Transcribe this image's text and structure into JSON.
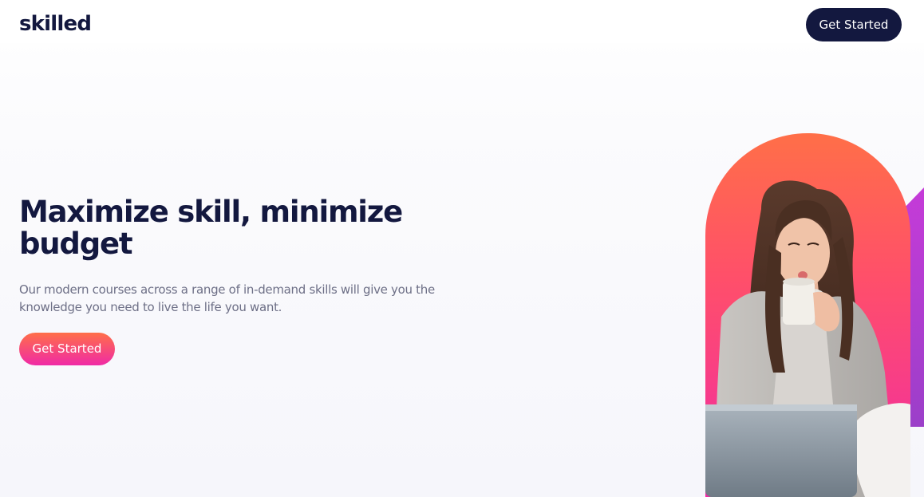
{
  "header": {
    "logo_text": "skilled",
    "cta_label": "Get Started"
  },
  "hero": {
    "title": "Maximize skill, minimize budget",
    "subtitle": "Our modern courses across a range of in-demand skills will give you the knowledge you need to live the life you want.",
    "cta_label": "Get Started",
    "image_icon": "woman-drinking-coffee-photo"
  },
  "colors": {
    "navy": "#13183f",
    "body_text": "#6d6f86",
    "gradient_start": "#ff6f48",
    "gradient_end": "#f02aa6",
    "purple_accent": "#b03ecf"
  }
}
